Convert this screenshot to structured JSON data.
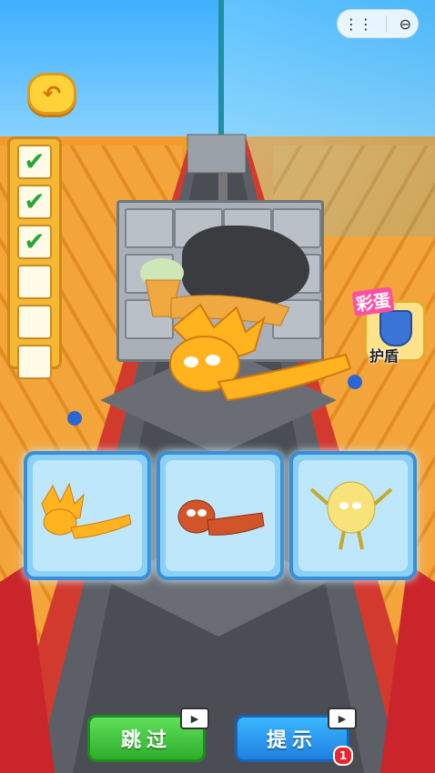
{
  "window": {
    "capsule_menu_icon": "more-dots-icon",
    "capsule_close_icon": "circle-minus-icon"
  },
  "header": {
    "back_icon": "undo-arrow-icon"
  },
  "progress": {
    "checks": [
      true,
      true,
      true,
      false,
      false,
      false
    ]
  },
  "shield_powerup": {
    "tag": "彩蛋",
    "label": "护盾",
    "icon": "shield-icon"
  },
  "choices": [
    {
      "name": "golden-flame-fry-figure"
    },
    {
      "name": "red-sausage-figure"
    },
    {
      "name": "cabbage-figure"
    }
  ],
  "actions": {
    "skip_label": "跳过",
    "hint_label": "提示",
    "hint_count": "1"
  },
  "colors": {
    "skip_green": "#2eae2c",
    "hint_blue": "#1f80e0",
    "card_border": "#3a8ed6",
    "badge_red": "#e8262c"
  }
}
